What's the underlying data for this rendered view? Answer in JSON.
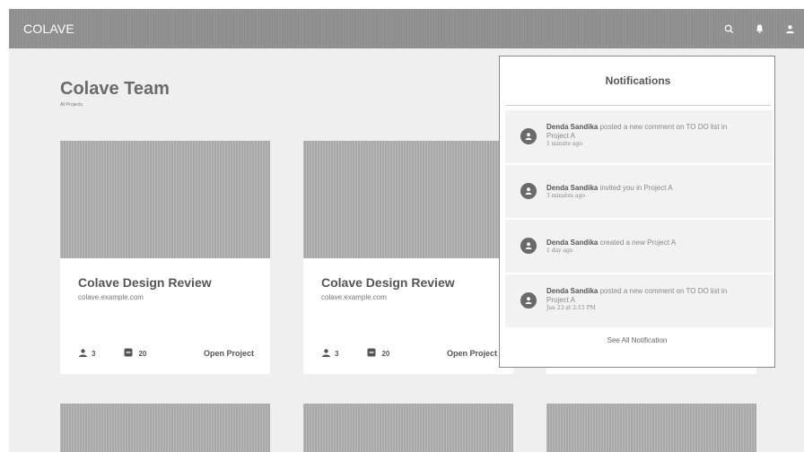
{
  "topbar": {
    "brand": "COLAVE"
  },
  "team": {
    "title": "Colave Team",
    "subtitle": "All Projects"
  },
  "projects": [
    {
      "title": "Colave Design Review",
      "url": "colave.example.com",
      "members": "3",
      "tasks": "20",
      "open_label": "Open Project"
    },
    {
      "title": "Colave Design Review",
      "url": "colave.example.com",
      "members": "3",
      "tasks": "20",
      "open_label": "Open Project"
    }
  ],
  "notifications": {
    "title": "Notifications",
    "items": [
      {
        "user": "Denda Sandika",
        "action": "posted a new comment on TO DO list in",
        "target": "Project A",
        "time": "1 minute ago"
      },
      {
        "user": "Denda Sandika",
        "action": "invited you  in Project A",
        "target": "",
        "time": "3 minutes ago"
      },
      {
        "user": "Denda Sandika",
        "action": "created a new Project A",
        "target": "",
        "time": "1 day  ago"
      },
      {
        "user": "Denda Sandika",
        "action": "posted a new comment on TO DO list in",
        "target": "Project A",
        "time": "Jan 23 at 2:15 PM"
      }
    ],
    "see_all": "See All Notification"
  },
  "icons": {
    "search": "search-icon",
    "bell": "bell-icon",
    "user": "user-icon"
  },
  "colors": {
    "topbar": "#8e8e8e",
    "background": "#efefef",
    "card": "#ffffff",
    "thumb": "#a9a9a9"
  }
}
